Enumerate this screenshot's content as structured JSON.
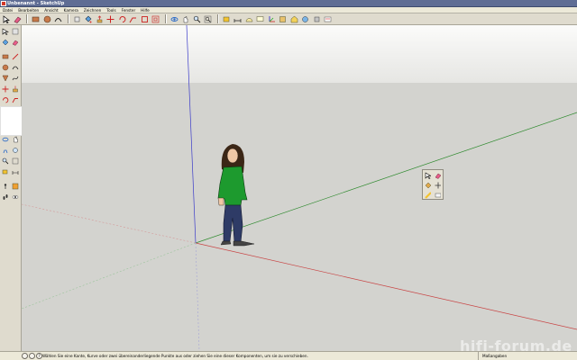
{
  "window": {
    "title": "Unbenannt - SketchUp"
  },
  "menu": {
    "items": [
      "Datei",
      "Bearbeiten",
      "Ansicht",
      "Kamera",
      "Zeichnen",
      "Tools",
      "Fenster",
      "Hilfe"
    ]
  },
  "toolbar_icons": [
    "select-icon",
    "eraser-icon",
    "rectangle-icon",
    "circle-icon",
    "arc-icon",
    "make-component-icon",
    "paint-bucket-icon",
    "push-pull-icon",
    "move-icon",
    "rotate-icon",
    "follow-me-icon",
    "scale-icon",
    "offset-icon",
    "orbit-icon",
    "pan-icon",
    "zoom-icon",
    "zoom-extents-icon",
    "tape-measure-icon",
    "dimension-icon",
    "protractor-icon",
    "text-icon",
    "axes-icon",
    "3d-text-icon",
    "warehouse-icon",
    "share-model-icon",
    "extension-icon",
    "send-to-layout-icon"
  ],
  "status": {
    "hint": "Wählen Sie eine Kante, Kurve oder zwei übereinanderliegende Punkte aus oder ziehen Sie eine dieser Komponenten, um sie zu verschieben.",
    "measurements_label": "Maßangaben"
  },
  "watermark": "hifi-forum.de",
  "colors": {
    "sky": "#f4f4f2",
    "ground": "#d3d3cf",
    "red_axis": "#c84545",
    "green_axis": "#2f8a2f",
    "blue_axis": "#3b3bc9",
    "figure_shirt": "#1d9a2e",
    "figure_jeans": "#2e3b66"
  }
}
